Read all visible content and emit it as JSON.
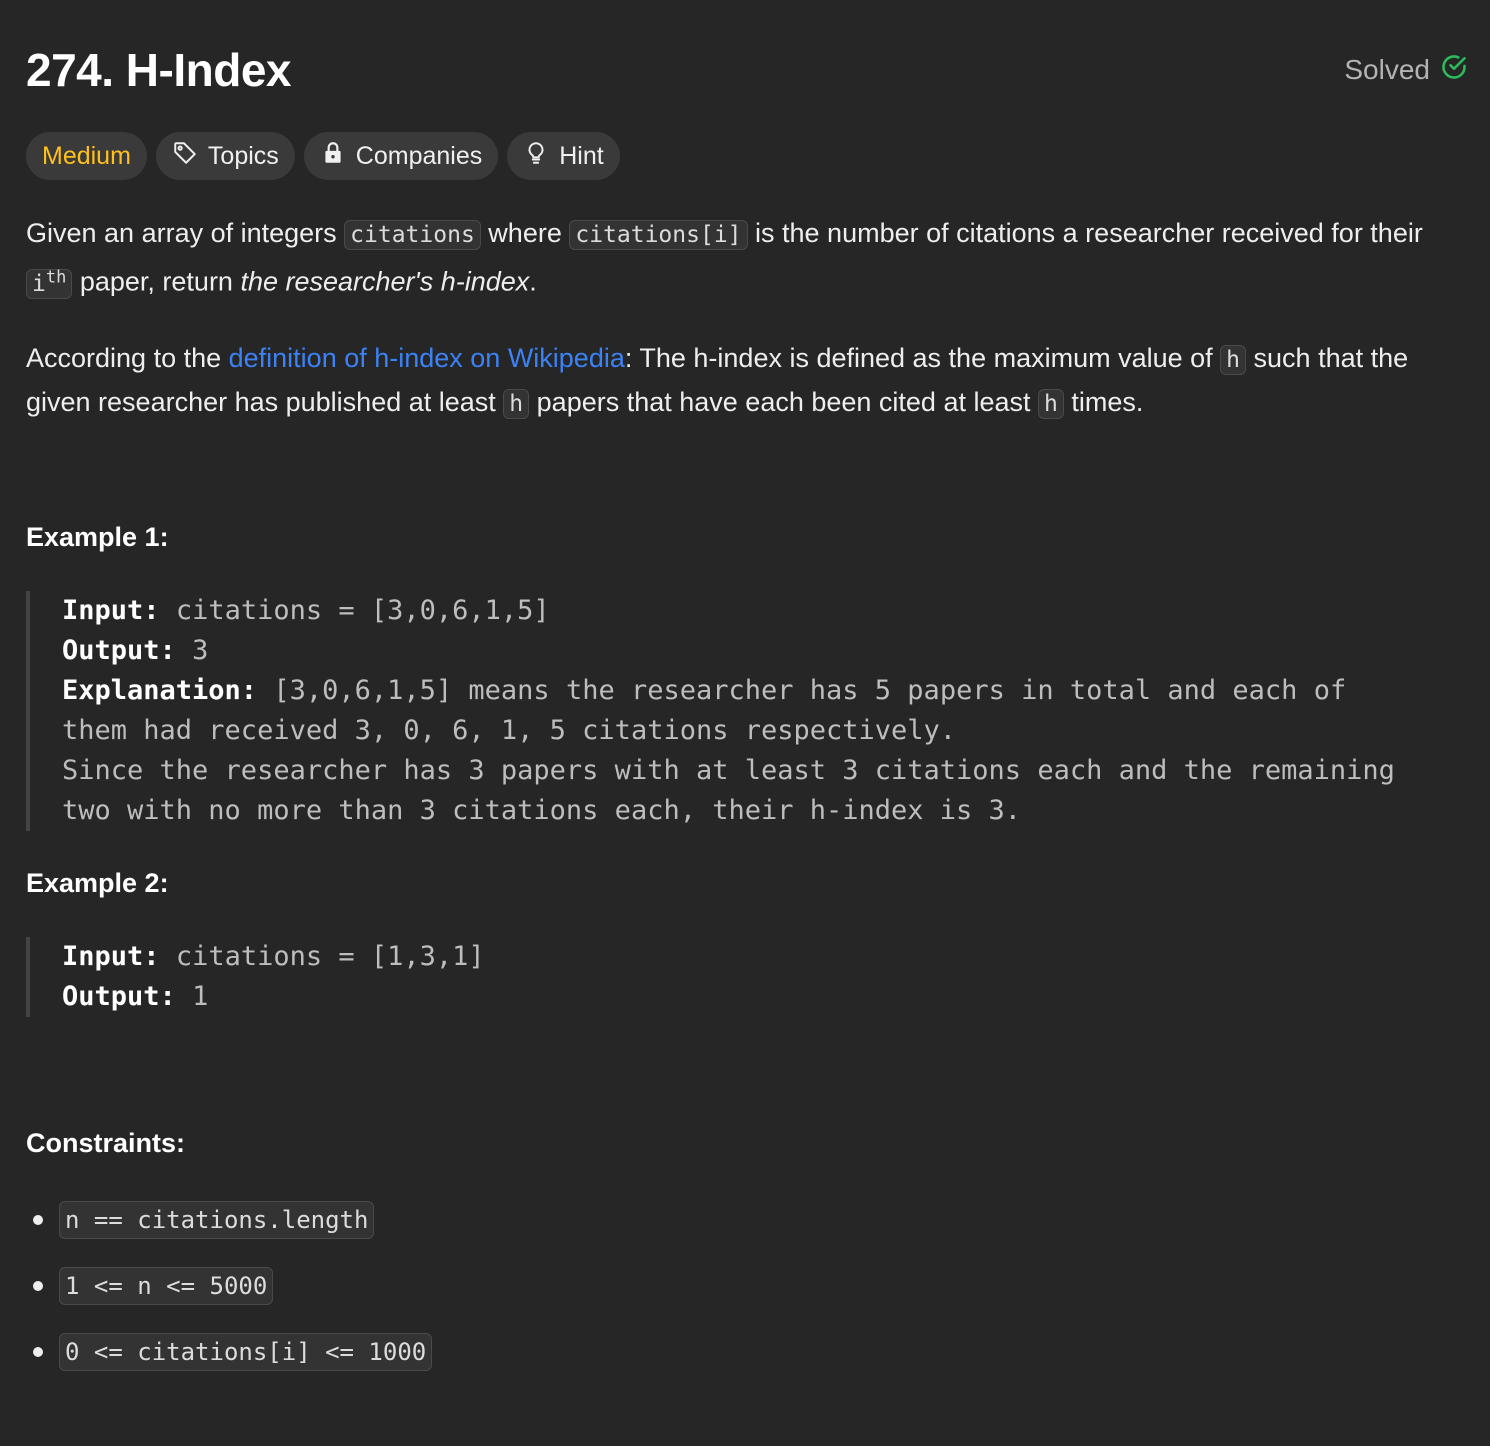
{
  "problem": {
    "title": "274. H-Index",
    "status": "Solved"
  },
  "tags": {
    "difficulty": "Medium",
    "topics": "Topics",
    "companies": "Companies",
    "hint": "Hint"
  },
  "description": {
    "p1_a": "Given an array of integers ",
    "p1_code1": "citations",
    "p1_b": " where ",
    "p1_code2": "citations[i]",
    "p1_c": " is the number of citations a researcher received for their ",
    "p1_code3": "i",
    "p1_sup": "th",
    "p1_d": " paper, return ",
    "p1_em": "the researcher's h-index",
    "p1_e": ".",
    "p2_a": "According to the ",
    "p2_link": "definition of h-index on Wikipedia",
    "p2_b": ": The h-index is defined as the maximum value of ",
    "p2_code1": "h",
    "p2_c": " such that the given researcher has published at least ",
    "p2_code2": "h",
    "p2_d": " papers that have each been cited at least ",
    "p2_code3": "h",
    "p2_e": " times."
  },
  "examples": [
    {
      "title": "Example 1:",
      "input_label": "Input:",
      "input": "citations = [3,0,6,1,5]",
      "output_label": "Output:",
      "output": "3",
      "explanation_label": "Explanation:",
      "explanation_lines": [
        "[3,0,6,1,5] means the researcher has 5 papers in total and each of",
        "them had received 3, 0, 6, 1, 5 citations respectively.",
        "Since the researcher has 3 papers with at least 3 citations each and the remaining",
        "two with no more than 3 citations each, their h-index is 3."
      ]
    },
    {
      "title": "Example 2:",
      "input_label": "Input:",
      "input": "citations = [1,3,1]",
      "output_label": "Output:",
      "output": "1"
    }
  ],
  "constraints": {
    "title": "Constraints:",
    "items": [
      "n == citations.length",
      "1 <= n <= 5000",
      "0 <= citations[i] <= 1000"
    ]
  },
  "colors": {
    "background": "#262626",
    "difficulty_medium": "#ffc01e",
    "solved_check": "#2cbb5d",
    "link": "#3b82f6"
  },
  "icons": {
    "solved": "check-circle-icon",
    "topics": "tag-icon",
    "companies": "lock-icon",
    "hint": "lightbulb-icon"
  }
}
